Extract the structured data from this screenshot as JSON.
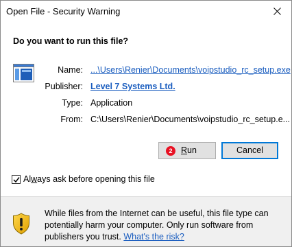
{
  "window": {
    "title": "Open File - Security Warning",
    "close_glyph": "close-icon"
  },
  "prompt": {
    "question": "Do you want to run this file?",
    "file_icon": "application-window-icon"
  },
  "details": {
    "name_label": "Name:",
    "name_value": "...\\Users\\Renier\\Documents\\voipstudio_rc_setup.exe",
    "publisher_label": "Publisher:",
    "publisher_value": "Level 7 Systems Ltd.",
    "type_label": "Type:",
    "type_value": "Application",
    "from_label": "From:",
    "from_value": "C:\\Users\\Renier\\Documents\\voipstudio_rc_setup.e..."
  },
  "buttons": {
    "run_badge": "2",
    "run_label": "Run",
    "cancel_label": "Cancel"
  },
  "checkbox": {
    "checked": true,
    "label": "Always ask before opening this file"
  },
  "warning": {
    "icon": "security-shield-warning-icon",
    "text": "While files from the Internet can be useful, this file type can potentially harm your computer. Only run software from publishers you trust.",
    "link": "What's the risk?"
  },
  "colors": {
    "link": "#1a5dbf",
    "focus_border": "#0078d7",
    "badge": "#e81123"
  }
}
